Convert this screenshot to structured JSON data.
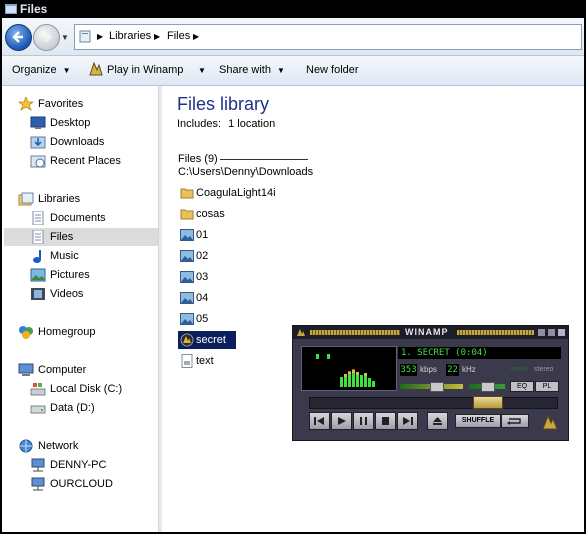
{
  "window": {
    "title": "Files"
  },
  "address": {
    "crumbs": [
      "Libraries",
      "Files"
    ]
  },
  "toolbar": {
    "organize": "Organize",
    "play": "Play in Winamp",
    "share": "Share with",
    "new_folder": "New folder"
  },
  "nav": {
    "favorites": {
      "label": "Favorites",
      "items": [
        "Desktop",
        "Downloads",
        "Recent Places"
      ]
    },
    "libraries": {
      "label": "Libraries",
      "items": [
        "Documents",
        "Files",
        "Music",
        "Pictures",
        "Videos"
      ],
      "selected": "Files"
    },
    "homegroup": "Homegroup",
    "computer": {
      "label": "Computer",
      "items": [
        "Local Disk (C:)",
        "Data (D:)"
      ]
    },
    "network": {
      "label": "Network",
      "items": [
        "DENNY-PC",
        "OURCLOUD"
      ]
    }
  },
  "main": {
    "title": "Files library",
    "includes_label": "Includes:",
    "includes_link": "1 location",
    "group_header": "Files (9)",
    "group_path": "C:\\Users\\Denny\\Downloads",
    "files": [
      {
        "name": "CoagulaLight14i",
        "icon": "folder-icon"
      },
      {
        "name": "cosas",
        "icon": "folder-icon"
      },
      {
        "name": "01",
        "icon": "image-file-icon"
      },
      {
        "name": "02",
        "icon": "image-file-icon"
      },
      {
        "name": "03",
        "icon": "image-file-icon"
      },
      {
        "name": "04",
        "icon": "image-file-icon"
      },
      {
        "name": "05",
        "icon": "image-file-icon"
      },
      {
        "name": "secret",
        "icon": "winamp-file-icon",
        "selected": true
      },
      {
        "name": "text",
        "icon": "text-file-icon"
      }
    ]
  },
  "winamp": {
    "title": "WINAMP",
    "song": "1. SECRET (0:04)",
    "kbps": "353",
    "kbps_label": "kbps",
    "khz": "22",
    "khz_label": "kHz",
    "mono_label": "mono",
    "stereo_label": "stereo",
    "eq_label": "EQ",
    "pl_label": "PL",
    "shuffle_label": "SHUFFLE",
    "colors": {
      "display_text": "#3fe03f",
      "body": "#3a3a4c",
      "accent": "#c9a53d"
    }
  }
}
